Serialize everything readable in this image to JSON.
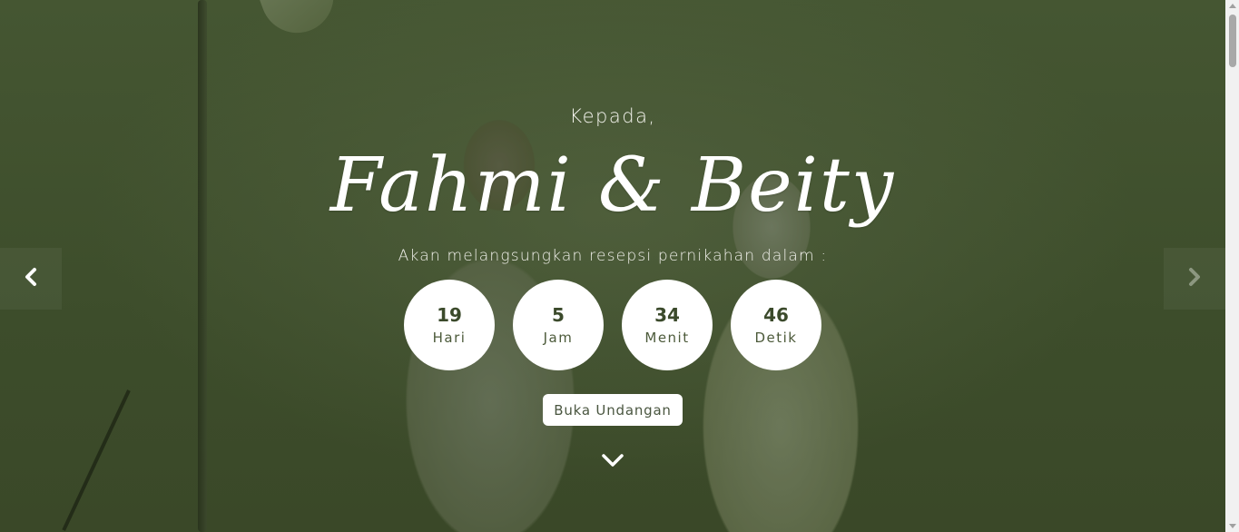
{
  "hero": {
    "greeting": "Kepada,",
    "couple_names": "Fahmi & Beity",
    "subtitle": "Akan melangsungkan resepsi pernikahan dalam :",
    "open_button_label": "Buka Undangan"
  },
  "countdown": [
    {
      "value": "19",
      "label": "Hari"
    },
    {
      "value": "5",
      "label": "Jam"
    },
    {
      "value": "34",
      "label": "Menit"
    },
    {
      "value": "46",
      "label": "Detik"
    }
  ],
  "icons": {
    "prev": "chevron-left-icon",
    "next": "chevron-right-icon",
    "scroll": "chevron-down-icon"
  },
  "colors": {
    "overlay": "#3f4f2c",
    "circle_bg": "#ffffff",
    "circle_text": "#3b4a2b"
  }
}
